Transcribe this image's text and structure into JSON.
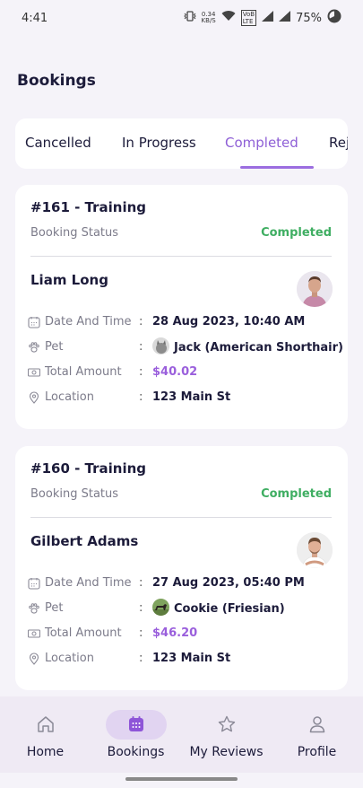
{
  "statusbar": {
    "time": "4:41",
    "net_speed": "0.34",
    "net_unit": "KB/S",
    "lte_top": "VoB",
    "lte_bottom": "LTE",
    "battery": "75%"
  },
  "page": {
    "title": "Bookings"
  },
  "tabs": [
    {
      "label": "Cancelled",
      "active": false
    },
    {
      "label": "In Progress",
      "active": false
    },
    {
      "label": "Completed",
      "active": true
    },
    {
      "label": "Rej",
      "active": false
    }
  ],
  "bookings": [
    {
      "title": "#161 - Training",
      "status_label": "Booking Status",
      "status": "Completed",
      "customer": "Liam Long",
      "date_label": "Date And Time",
      "date": "28 Aug 2023, 10:40 AM",
      "pet_label": "Pet",
      "pet": "Jack (American Shorthair)",
      "amount_label": "Total Amount",
      "amount": "$40.02",
      "location_label": "Location",
      "location": "123 Main St"
    },
    {
      "title": "#160 - Training",
      "status_label": "Booking Status",
      "status": "Completed",
      "customer": "Gilbert Adams",
      "date_label": "Date And Time",
      "date": "27 Aug 2023, 05:40 PM",
      "pet_label": "Pet",
      "pet": "Cookie (Friesian)",
      "amount_label": "Total Amount",
      "amount": "$46.20",
      "location_label": "Location",
      "location": "123 Main St"
    }
  ],
  "colon": ":",
  "nav": [
    {
      "label": "Home",
      "icon": "home-icon",
      "active": false
    },
    {
      "label": "Bookings",
      "icon": "calendar-icon",
      "active": true
    },
    {
      "label": "My Reviews",
      "icon": "star-icon",
      "active": false
    },
    {
      "label": "Profile",
      "icon": "person-icon",
      "active": false
    }
  ],
  "colors": {
    "accent": "#9c6ee0",
    "completed": "#3fae62",
    "amount": "#9a5fdc",
    "nav_background": "#efeaf4"
  }
}
